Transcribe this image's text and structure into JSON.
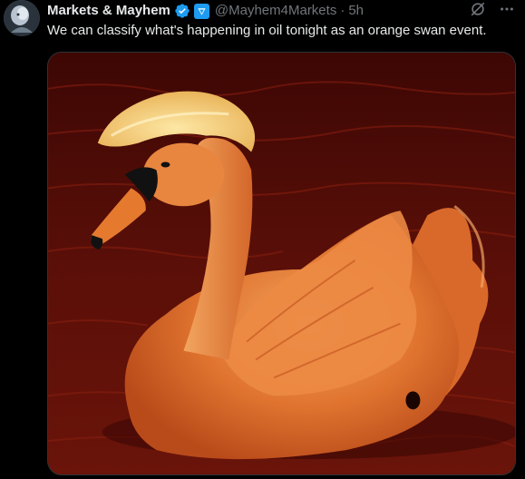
{
  "tweet": {
    "display_name": "Markets & Mayhem",
    "handle": "@Mayhem4Markets",
    "separator": "·",
    "time": "5h",
    "text": "We can classify what's happening in oil tonight as an orange swan event.",
    "icons": {
      "avatar": "avatar-image",
      "verified": "verified-badge-icon",
      "affiliate": "affiliate-badge-icon",
      "grok": "grok-icon",
      "more": "more-icon"
    },
    "media": {
      "description_icon": "orange-swan-image"
    }
  },
  "colors": {
    "accent": "#1d9bf0",
    "text_primary": "#e7e9ea",
    "text_secondary": "#71767b",
    "background": "#000000"
  }
}
